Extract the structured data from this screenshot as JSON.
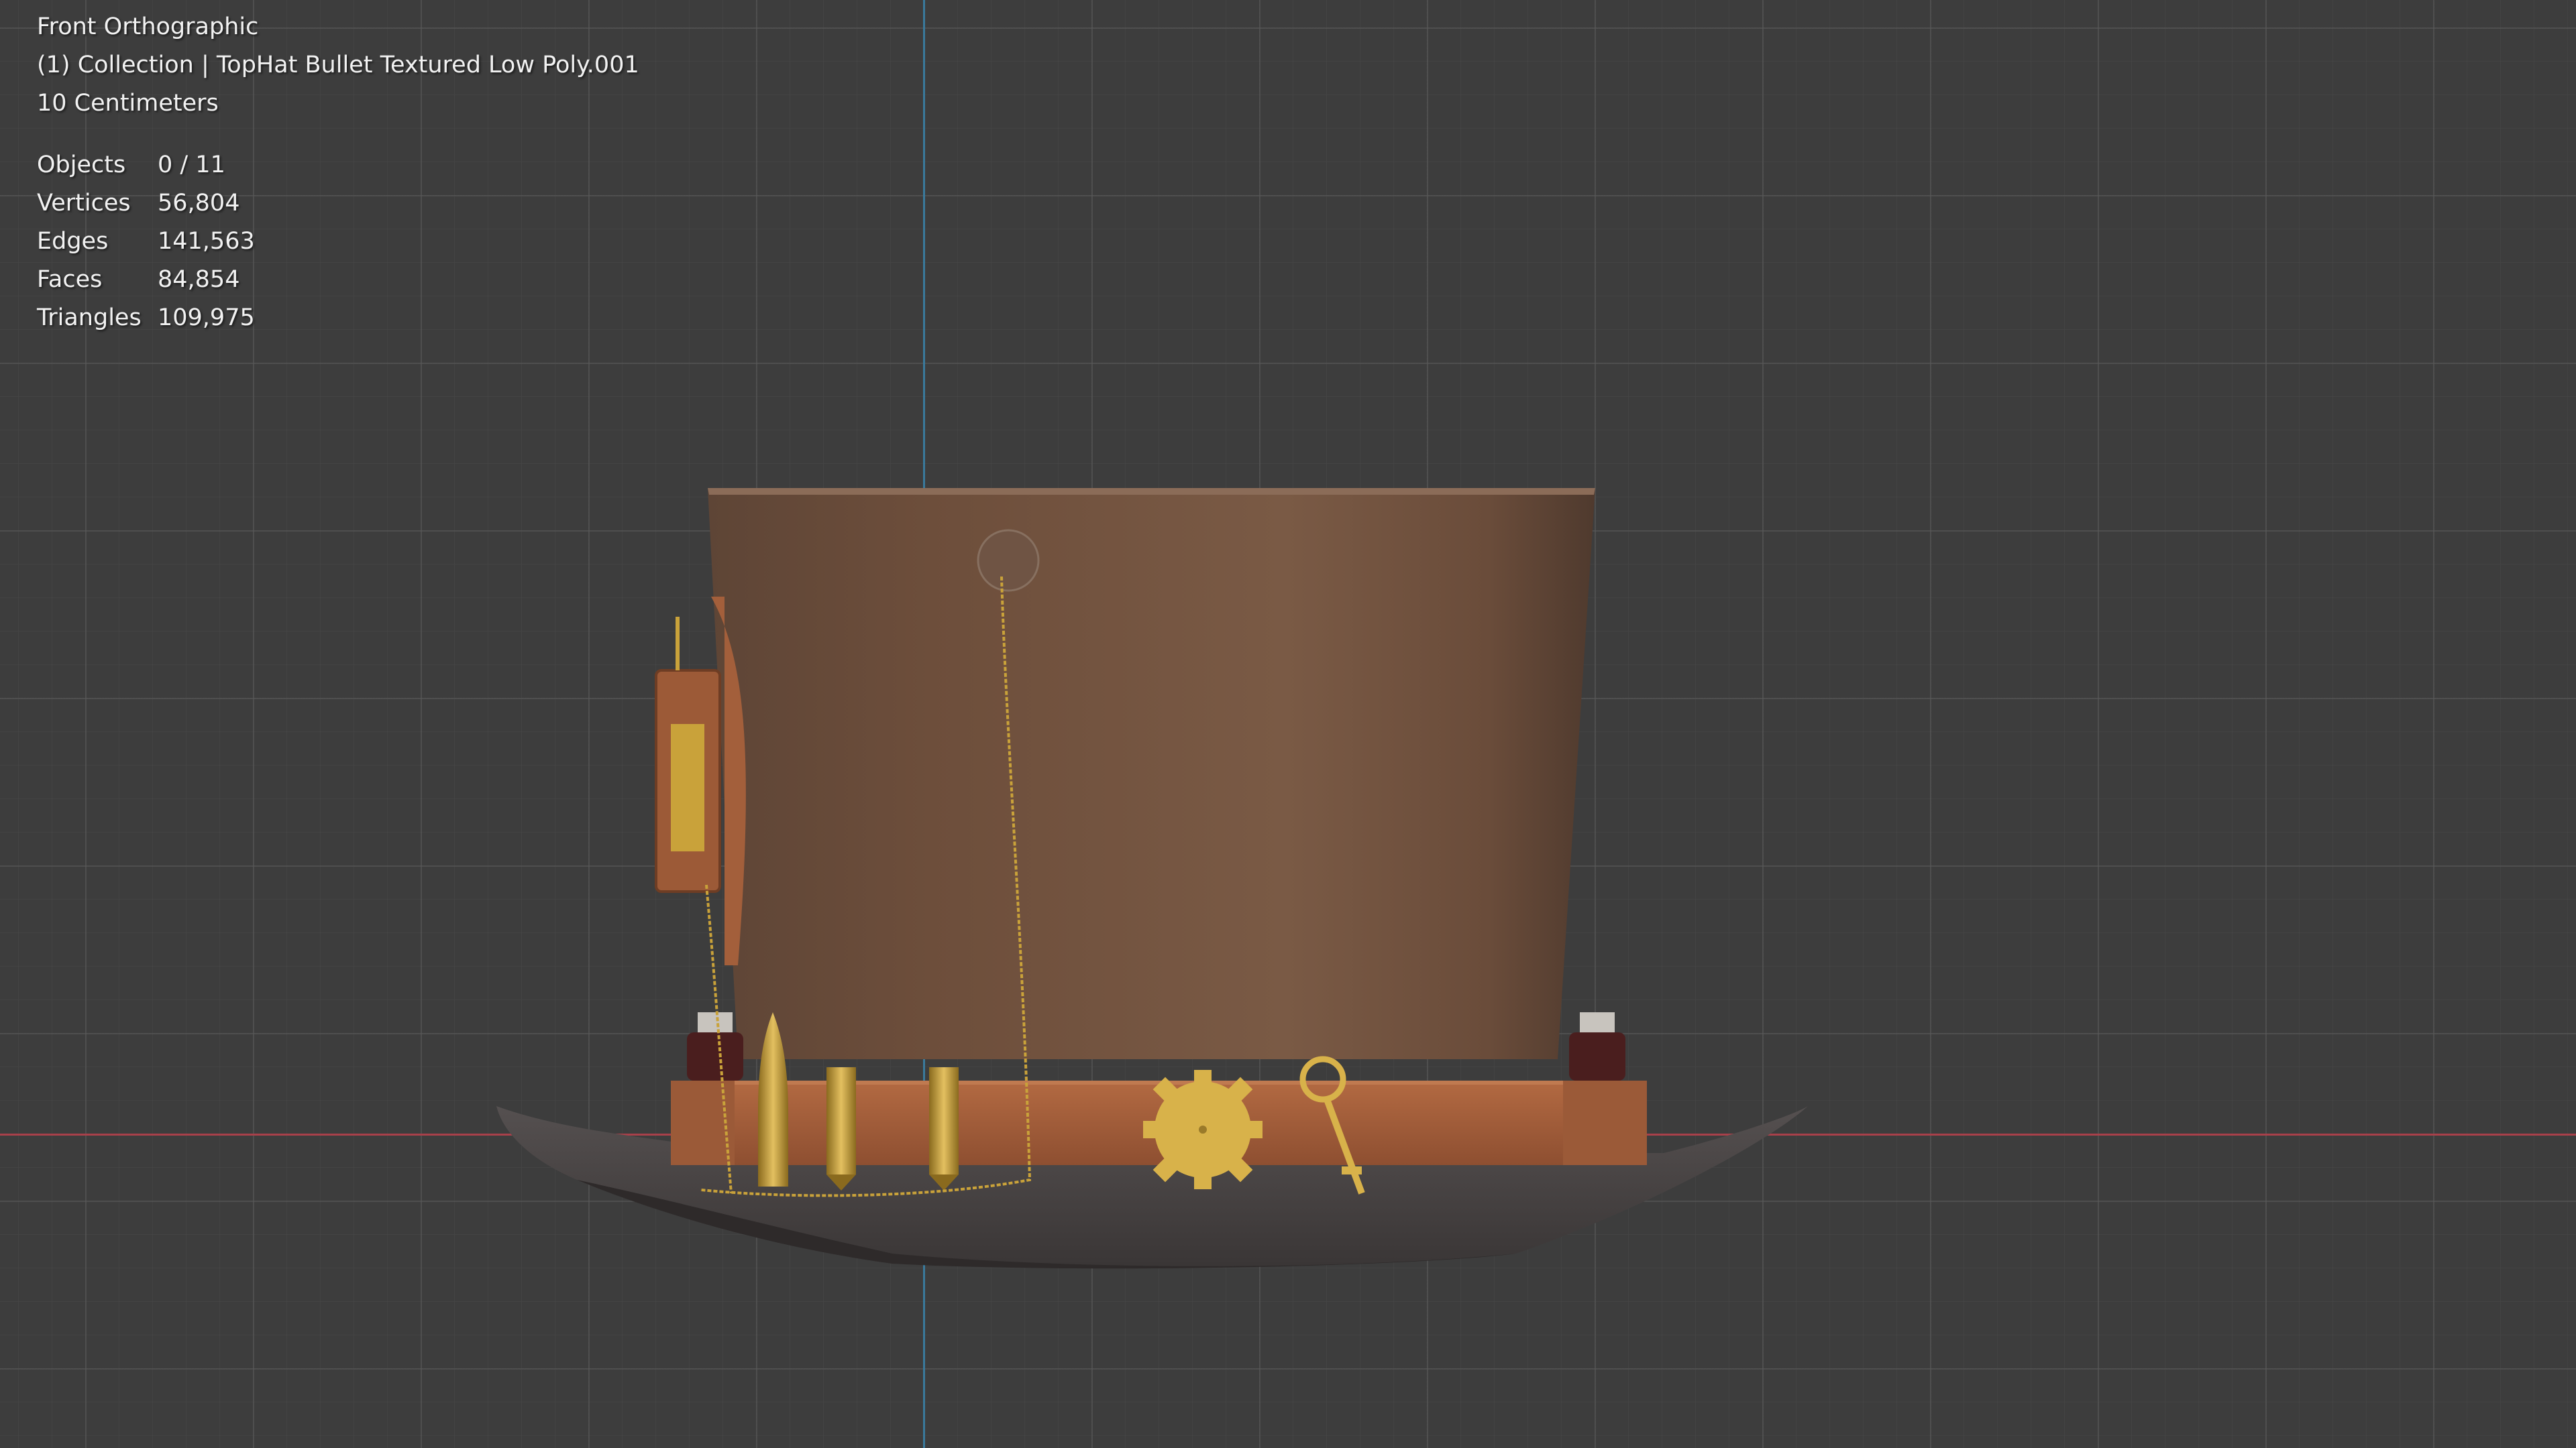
{
  "overlay": {
    "view_name": "Front Orthographic",
    "collection": "(1) Collection | TopHat Bullet Textured Low Poly.001",
    "scale": "10 Centimeters"
  },
  "stats": [
    {
      "label": "Objects",
      "value": "0 / 11"
    },
    {
      "label": "Vertices",
      "value": "56,804"
    },
    {
      "label": "Edges",
      "value": "141,563"
    },
    {
      "label": "Faces",
      "value": "84,854"
    },
    {
      "label": "Triangles",
      "value": "109,975"
    }
  ],
  "colors": {
    "viewport_bg": "#3d3d3d",
    "axis_x": "#a8404a",
    "axis_z": "#3a7a9c",
    "hat_leather": "#6e4f3c",
    "band_leather": "#a35f3b",
    "brass": "#c9a23a",
    "brim": "#4a4442"
  }
}
